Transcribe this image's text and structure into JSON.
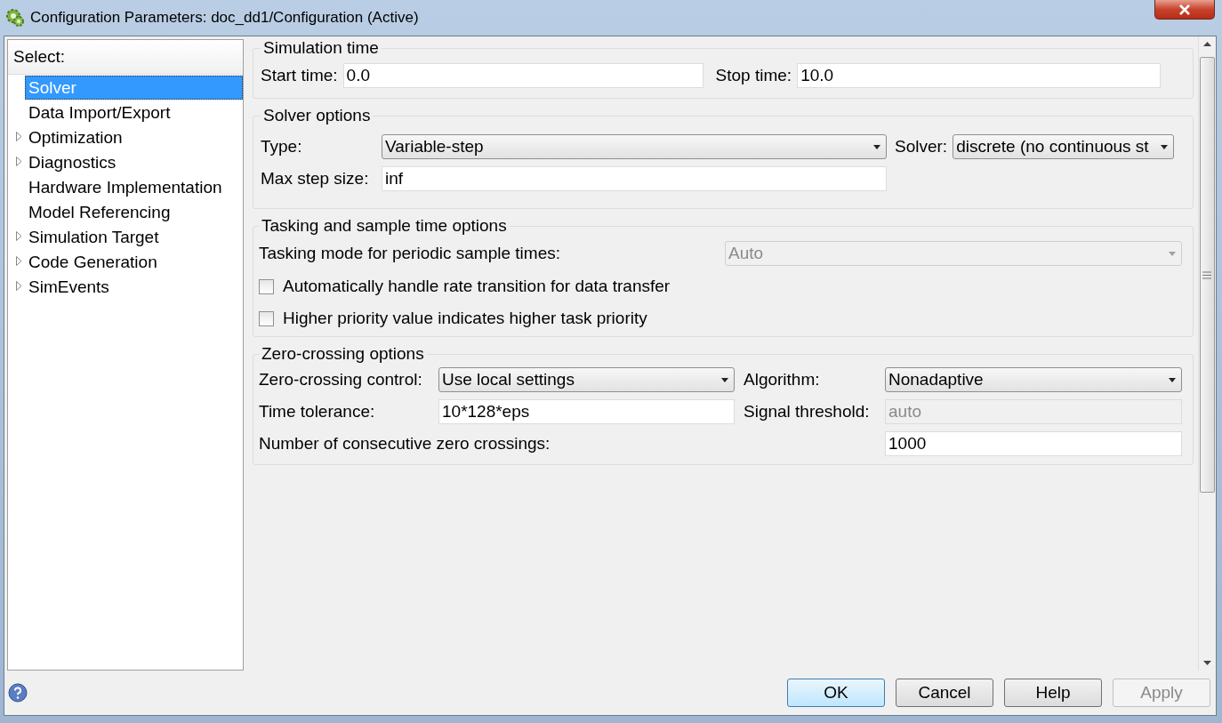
{
  "window": {
    "title": "Configuration Parameters: doc_dd1/Configuration (Active)"
  },
  "sidebar": {
    "header": "Select:",
    "items": [
      {
        "label": "Solver",
        "selected": true,
        "expandable": false
      },
      {
        "label": "Data Import/Export",
        "selected": false,
        "expandable": false
      },
      {
        "label": "Optimization",
        "selected": false,
        "expandable": true
      },
      {
        "label": "Diagnostics",
        "selected": false,
        "expandable": true
      },
      {
        "label": "Hardware Implementation",
        "selected": false,
        "expandable": false
      },
      {
        "label": "Model Referencing",
        "selected": false,
        "expandable": false
      },
      {
        "label": "Simulation Target",
        "selected": false,
        "expandable": true
      },
      {
        "label": "Code Generation",
        "selected": false,
        "expandable": true
      },
      {
        "label": "SimEvents",
        "selected": false,
        "expandable": true
      }
    ]
  },
  "simulation_time": {
    "title": "Simulation time",
    "start_time": {
      "label": "Start time:",
      "value": "0.0"
    },
    "stop_time": {
      "label": "Stop time:",
      "value": "10.0"
    }
  },
  "solver_options": {
    "title": "Solver options",
    "type": {
      "label": "Type:",
      "value": "Variable-step"
    },
    "solver": {
      "label": "Solver:",
      "value": "discrete (no continuous st"
    },
    "max_step_size": {
      "label": "Max step size:",
      "value": "inf"
    }
  },
  "tasking": {
    "title": "Tasking and sample time options",
    "tasking_mode": {
      "label": "Tasking mode for periodic sample times:",
      "value": "Auto",
      "disabled": true
    },
    "checkboxes": [
      {
        "label": "Automatically handle rate transition for data transfer",
        "checked": false
      },
      {
        "label": "Higher priority value indicates higher task priority",
        "checked": false
      }
    ]
  },
  "zero_crossing": {
    "title": "Zero-crossing options",
    "control": {
      "label": "Zero-crossing control:",
      "value": "Use local settings"
    },
    "algorithm": {
      "label": "Algorithm:",
      "value": "Nonadaptive"
    },
    "time_tolerance": {
      "label": "Time tolerance:",
      "value": "10*128*eps",
      "disabled": false
    },
    "signal_threshold": {
      "label": "Signal threshold:",
      "value": "auto",
      "disabled": true
    },
    "consecutive": {
      "label": "Number of consecutive zero crossings:",
      "value": "1000"
    }
  },
  "buttons": [
    {
      "label": "OK",
      "default": true,
      "disabled": false
    },
    {
      "label": "Cancel",
      "default": false,
      "disabled": false
    },
    {
      "label": "Help",
      "default": false,
      "disabled": false
    },
    {
      "label": "Apply",
      "default": false,
      "disabled": true
    }
  ]
}
